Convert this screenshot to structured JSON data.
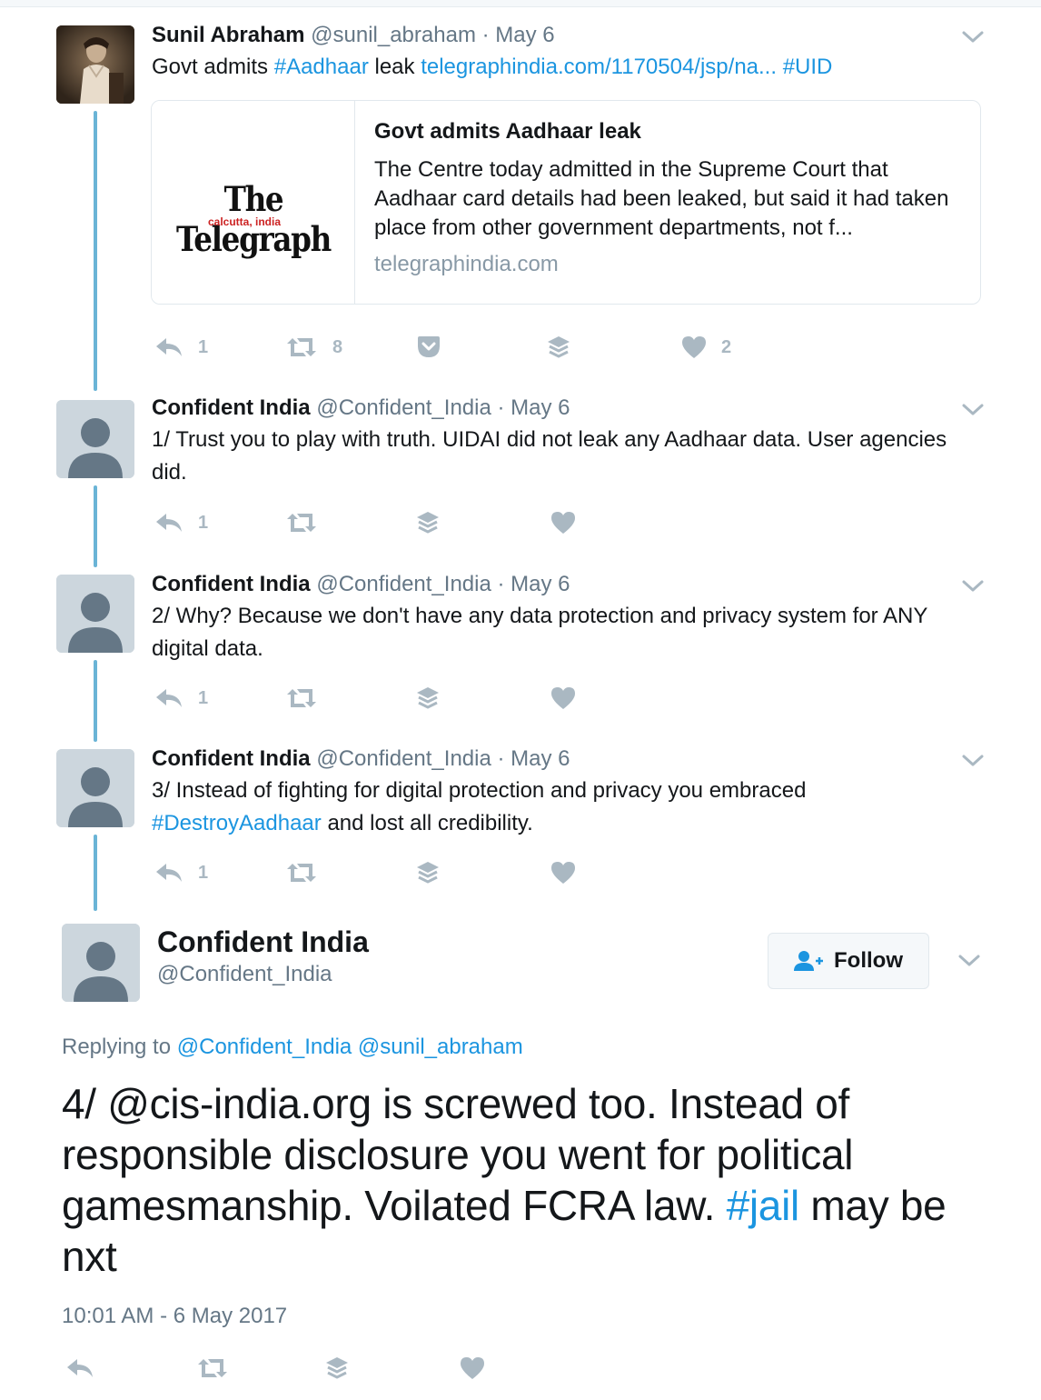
{
  "thread": [
    {
      "name": "Sunil Abraham",
      "handle": "@sunil_abraham",
      "separator": "·",
      "date": "May 6",
      "text_parts": {
        "p1": "Govt admits ",
        "hashtag1": "#Aadhaar",
        "p2": " leak ",
        "url": "telegraphindia.com/1170504/jsp/na...",
        "p3": " ",
        "hashtag2": "#UID"
      },
      "card": {
        "logo_text": "The Telegraph",
        "logo_sub": "calcutta, india",
        "title": "Govt admits Aadhaar leak",
        "description": "The Centre today admitted in the Supreme Court that Aadhaar card details had been leaked, but said it had taken place from other government departments, not f...",
        "domain": "telegraphindia.com"
      },
      "replies": "1",
      "retweets": "8",
      "likes": "2"
    },
    {
      "name": "Confident India",
      "handle": "@Confident_India",
      "separator": "·",
      "date": "May 6",
      "text": "1/ Trust you to play with truth. UIDAI did not leak any Aadhaar data. User agencies did.",
      "replies": "1"
    },
    {
      "name": "Confident India",
      "handle": "@Confident_India",
      "separator": "·",
      "date": "May 6",
      "text": "2/ Why? Because we don't have any data protection and privacy system for ANY digital data.",
      "replies": "1"
    },
    {
      "name": "Confident India",
      "handle": "@Confident_India",
      "separator": "·",
      "date": "May 6",
      "text_parts": {
        "p1": "3/ Instead of fighting for digital protection and privacy you embraced ",
        "hashtag": "#DestroyAadhaar",
        "p2": " and lost all credibility."
      },
      "replies": "1"
    }
  ],
  "main_tweet": {
    "name": "Confident India",
    "handle": "@Confident_India",
    "follow_label": "Follow",
    "replying_label": "Replying to ",
    "replying_to_1": "@Confident_India",
    "replying_to_2": "@sunil_abraham",
    "text_p1": "4/ @cis-india.org is screwed too. Instead of responsible disclosure you went for political gamesmanship. Voilated FCRA law. ",
    "text_hashtag": "#jail",
    "text_p2": " may be nxt",
    "timestamp": "10:01 AM - 6 May 2017"
  },
  "colors": {
    "link": "#1b95e0",
    "thread_line": "#6ab4d6",
    "icon": "#aab8c2",
    "muted_text": "#657786"
  },
  "icons": [
    "reply-icon",
    "retweet-icon",
    "pocket-icon",
    "buffer-icon",
    "heart-icon",
    "chevron-down-icon",
    "follow-user-icon",
    "default-avatar-icon"
  ]
}
